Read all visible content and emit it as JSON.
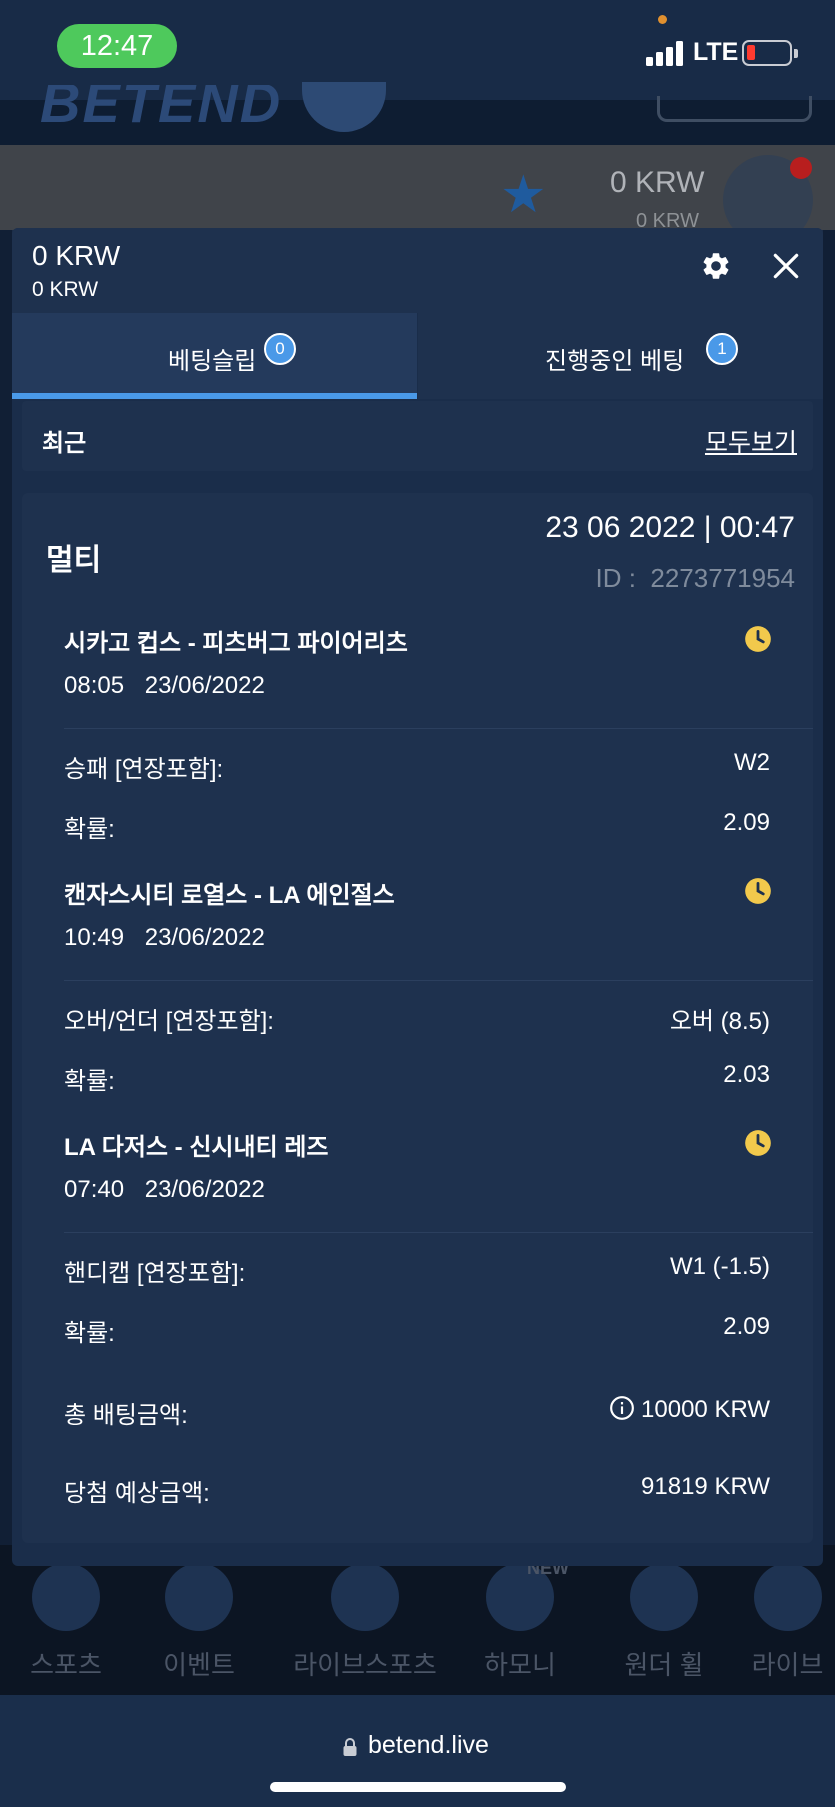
{
  "status_bar": {
    "time": "12:47",
    "network": "LTE"
  },
  "background": {
    "logo": "BETEND",
    "balance": "0 KRW",
    "balance_sub": "0 KRW",
    "nav": [
      {
        "label": "스포츠",
        "icon": "soccer-ball-icon"
      },
      {
        "label": "이벤트",
        "icon": "gift-icon"
      },
      {
        "label": "라이브스포츠",
        "icon": "live-tv-icon"
      },
      {
        "label": "하모니",
        "icon": "trophy-icon"
      },
      {
        "label": "원더 휠",
        "icon": "wheel-icon"
      },
      {
        "label": "라이브",
        "icon": "roulette-icon"
      }
    ],
    "new_badge": "NEW"
  },
  "slip": {
    "balance_main": "0 KRW",
    "balance_sub": "0 KRW",
    "tabs": [
      {
        "label": "베팅슬립",
        "count": "0"
      },
      {
        "label": "진행중인 베팅",
        "count": "1"
      }
    ],
    "recent_label": "최근",
    "view_all_label": "모두보기",
    "bet": {
      "type": "멀티",
      "datetime": "23 06 2022 | 00:47",
      "id_label": "ID :",
      "id_value": "2273771954",
      "events": [
        {
          "match": "시카고 컵스 - 피츠버그 파이어리츠",
          "time": "08:05",
          "date": "23/06/2022",
          "market": "승패 [연장포함]:",
          "selection": "W2",
          "odds_label": "확률:",
          "odds": "2.09"
        },
        {
          "match": "캔자스시티 로열스 - LA 에인절스",
          "time": "10:49",
          "date": "23/06/2022",
          "market": "오버/언더 [연장포함]:",
          "selection": "오버 (8.5)",
          "odds_label": "확률:",
          "odds": "2.03"
        },
        {
          "match": "LA 다저스 - 신시내티 레즈",
          "time": "07:40",
          "date": "23/06/2022",
          "market": "핸디캡 [연장포함]:",
          "selection": "W1 (-1.5)",
          "odds_label": "확률:",
          "odds": "2.09"
        }
      ],
      "total_stake_label": "총 배팅금액:",
      "total_stake": "10000 KRW",
      "potential_win_label": "당첨 예상금액:",
      "potential_win": "91819 KRW"
    }
  },
  "browser": {
    "url": "betend.live"
  },
  "colors": {
    "accent": "#4a99e8",
    "pending_clock": "#f2c94c",
    "panel": "#1e314e"
  }
}
